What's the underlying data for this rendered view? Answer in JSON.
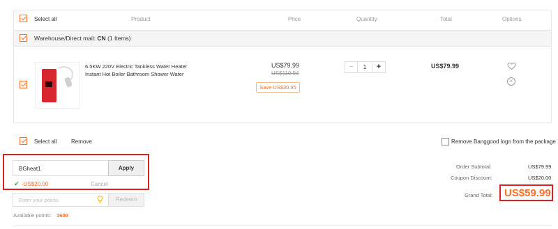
{
  "header": {
    "select_all": "Select all",
    "product": "Product",
    "price": "Price",
    "quantity": "Quantity",
    "total": "Total",
    "options": "Options"
  },
  "warehouse": {
    "label": "Warehouse/Direct mail:",
    "country": "CN",
    "count": "(1 Items)"
  },
  "item": {
    "title_line1": "6.5KW 220V Electric Tankless Water Heater",
    "title_line2": "Instant Hot Boiler Bathroom Shower Water",
    "price": "US$79.99",
    "original_price": "US$110.94",
    "save": "Save US$30.95",
    "qty_minus": "−",
    "quantity": "1",
    "qty_plus": "+",
    "total": "US$79.99",
    "icons": [
      "heart-icon",
      "remove-icon"
    ]
  },
  "footer_bar": {
    "select_all": "Select all",
    "remove": "Remove",
    "remove_logo": "Remove Banggood logo from the package"
  },
  "coupon": {
    "code": "BGheat1",
    "apply": "Apply",
    "discount": "-US$20.00",
    "cancel": "Cancel"
  },
  "points": {
    "placeholder": "Enter your points",
    "redeem": "Redeem",
    "available_label": "Available points:",
    "available_value": "1600"
  },
  "summary": {
    "subtotal_label": "Order Subtotal:",
    "subtotal_value": "US$79.99",
    "discount_label": "Coupon Discount:",
    "discount_value": "US$20.00",
    "grand_label": "Grand Total:",
    "grand_value": "US$59.99"
  },
  "colors": {
    "accent": "#ff6e26",
    "highlight_border": "#e02020",
    "check_green": "#3aa52f"
  }
}
